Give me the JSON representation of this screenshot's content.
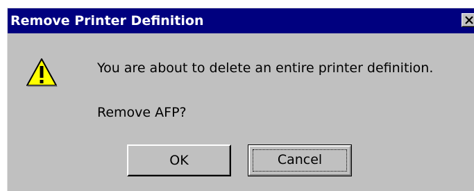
{
  "dialog": {
    "title": "Remove Printer Definition",
    "close_icon": "close-icon",
    "icon": "warning-icon",
    "message": "You are about to delete an entire printer definition.",
    "question": "Remove AFP?",
    "ok_label": "OK",
    "cancel_label": "Cancel"
  },
  "colors": {
    "titlebar": "#00007f",
    "dialog_bg": "#c0c0c0",
    "warning_yellow": "#ffff00"
  }
}
